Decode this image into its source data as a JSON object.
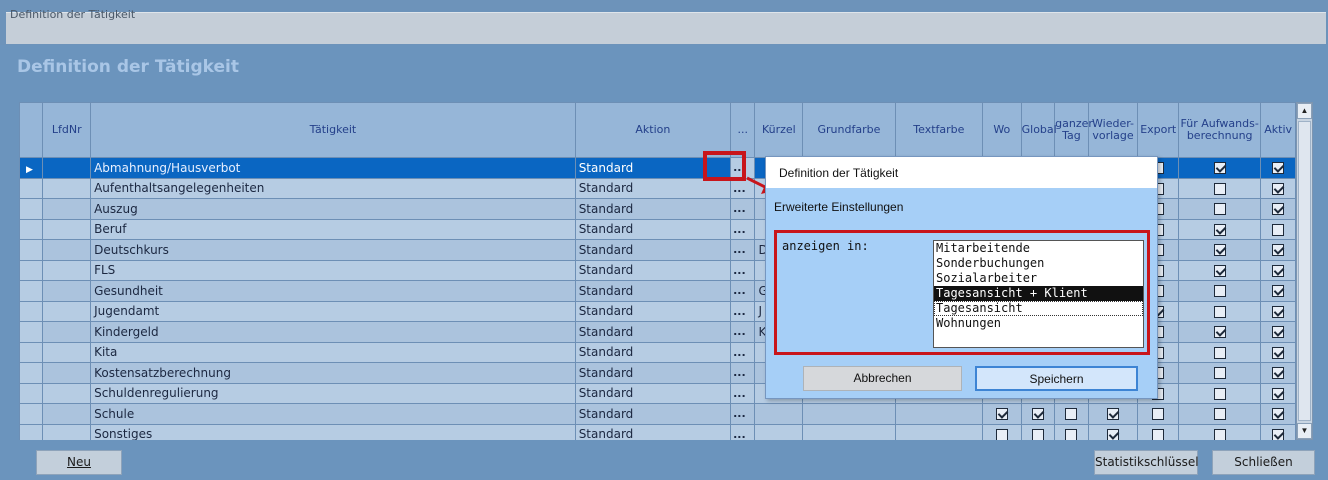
{
  "window": {
    "title": "Definition der Tätigkeit"
  },
  "page": {
    "title": "Definition der Tätigkeit"
  },
  "colors": {
    "accent": "#0a66c2",
    "highlight": "#c8151b",
    "header_text": "#24408a"
  },
  "grid": {
    "columns": [
      "",
      "LfdNr",
      "Tätigkeit",
      "Aktion",
      "...",
      "Kürzel",
      "Grundfarbe",
      "Textfarbe",
      "Wo",
      "Global",
      "ganzer Tag",
      "Wieder-vorlage",
      "Export",
      "Für Aufwands-berechnung",
      "Aktiv"
    ],
    "rows": [
      {
        "taetigkeit": "Abmahnung/Hausverbot",
        "aktion": "Standard",
        "dots": "...",
        "kuerzel": "",
        "wo": null,
        "global": null,
        "ganzer_tag": null,
        "wiedervorlage": null,
        "export": false,
        "aufwand": true,
        "aktiv": true,
        "selected": true
      },
      {
        "taetigkeit": "Aufenthaltsangelegenheiten",
        "aktion": "Standard",
        "dots": "...",
        "kuerzel": "",
        "export": false,
        "aufwand": false,
        "aktiv": true
      },
      {
        "taetigkeit": "Auszug",
        "aktion": "Standard",
        "dots": "...",
        "kuerzel": "",
        "export": false,
        "aufwand": false,
        "aktiv": true
      },
      {
        "taetigkeit": "Beruf",
        "aktion": "Standard",
        "dots": "...",
        "kuerzel": "",
        "export": false,
        "aufwand": true,
        "aktiv": false
      },
      {
        "taetigkeit": "Deutschkurs",
        "aktion": "Standard",
        "dots": "...",
        "kuerzel": "D",
        "export": false,
        "aufwand": true,
        "aktiv": true
      },
      {
        "taetigkeit": "FLS",
        "aktion": "Standard",
        "dots": "...",
        "kuerzel": "",
        "export": false,
        "aufwand": true,
        "aktiv": true
      },
      {
        "taetigkeit": "Gesundheit",
        "aktion": "Standard",
        "dots": "...",
        "kuerzel": "G",
        "export": false,
        "aufwand": false,
        "aktiv": true
      },
      {
        "taetigkeit": "Jugendamt",
        "aktion": "Standard",
        "dots": "...",
        "kuerzel": "J",
        "export": true,
        "aufwand": false,
        "aktiv": true
      },
      {
        "taetigkeit": "Kindergeld",
        "aktion": "Standard",
        "dots": "...",
        "kuerzel": "K",
        "export": false,
        "aufwand": true,
        "aktiv": true
      },
      {
        "taetigkeit": "Kita",
        "aktion": "Standard",
        "dots": "...",
        "kuerzel": "",
        "export": false,
        "aufwand": false,
        "aktiv": true
      },
      {
        "taetigkeit": "Kostensatzberechnung",
        "aktion": "Standard",
        "dots": "...",
        "kuerzel": "",
        "export": false,
        "aufwand": false,
        "aktiv": true
      },
      {
        "taetigkeit": "Schuldenregulierung",
        "aktion": "Standard",
        "dots": "...",
        "kuerzel": "",
        "export": false,
        "aufwand": false,
        "aktiv": true
      },
      {
        "taetigkeit": "Schule",
        "aktion": "Standard",
        "dots": "...",
        "kuerzel": "",
        "wo": true,
        "global": true,
        "ganzer_tag": false,
        "wiedervorlage": true,
        "export": false,
        "aufwand": false,
        "aktiv": true
      },
      {
        "taetigkeit": "Sonstiges",
        "aktion": "Standard",
        "dots": "...",
        "kuerzel": "",
        "wo": false,
        "global": false,
        "ganzer_tag": false,
        "wiedervorlage": true,
        "export": false,
        "aufwand": false,
        "aktiv": true
      }
    ]
  },
  "buttons": {
    "neu": "Neu",
    "statistik": "Statistikschlüssel",
    "schliessen": "Schließen"
  },
  "dialog": {
    "title": "Definition der Tätigkeit",
    "subtitle": "Erweiterte Einstellungen",
    "label": "anzeigen in:",
    "options": [
      "Mitarbeitende",
      "Sonderbuchungen",
      "Sozialarbeiter",
      "Tagesansicht + Klient",
      "Tagesansicht",
      "Wohnungen"
    ],
    "selected_index": 3,
    "focus_index": 4,
    "cancel": "Abbrechen",
    "save": "Speichern"
  }
}
